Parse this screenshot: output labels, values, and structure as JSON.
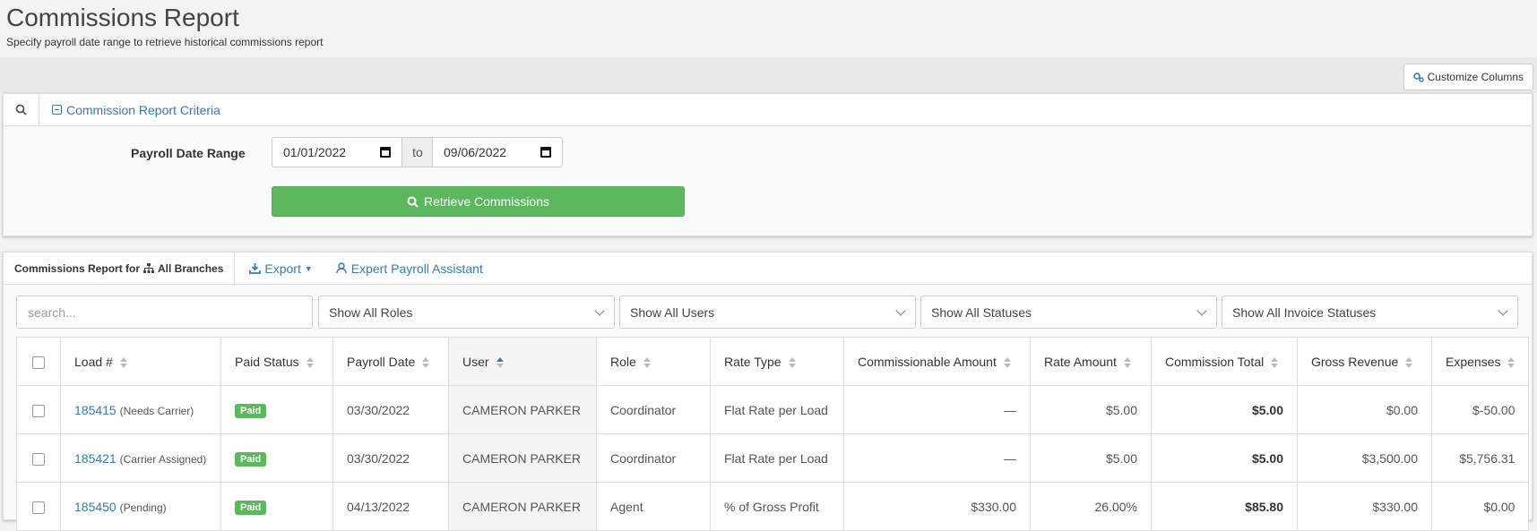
{
  "page": {
    "title": "Commissions Report",
    "subtitle": "Specify payroll date range to retrieve historical commissions report"
  },
  "toolbar": {
    "customize_label": "Customize Columns"
  },
  "criteria": {
    "header_label": "Commission Report Criteria",
    "range_label": "Payroll Date Range",
    "from_date": "01/01/2022",
    "to_label": "to",
    "to_date": "09/06/2022",
    "retrieve_label": "Retrieve Commissions"
  },
  "report": {
    "title_prefix": "Commissions Report for",
    "branch_label": "All Branches",
    "export_label": "Export",
    "assistant_label": "Expert Payroll Assistant",
    "search_placeholder": "search...",
    "filters": [
      "Show All Roles",
      "Show All Users",
      "Show All Statuses",
      "Show All Invoice Statuses"
    ],
    "columns": [
      "Load #",
      "Paid Status",
      "Payroll Date",
      "User",
      "Role",
      "Rate Type",
      "Commissionable Amount",
      "Rate Amount",
      "Commission Total",
      "Gross Revenue",
      "Expenses"
    ],
    "rows": [
      {
        "load": "185415",
        "load_status": "(Needs Carrier)",
        "paid": "Paid",
        "date": "03/30/2022",
        "user": "CAMERON PARKER",
        "role": "Coordinator",
        "rate_type": "Flat Rate per Load",
        "commissionable": "—",
        "rate": "$5.00",
        "total": "$5.00",
        "gross": "$0.00",
        "expenses": "$-50.00"
      },
      {
        "load": "185421",
        "load_status": "(Carrier Assigned)",
        "paid": "Paid",
        "date": "03/30/2022",
        "user": "CAMERON PARKER",
        "role": "Coordinator",
        "rate_type": "Flat Rate per Load",
        "commissionable": "—",
        "rate": "$5.00",
        "total": "$5.00",
        "gross": "$3,500.00",
        "expenses": "$5,756.31"
      },
      {
        "load": "185450",
        "load_status": "(Pending)",
        "paid": "Paid",
        "date": "04/13/2022",
        "user": "CAMERON PARKER",
        "role": "Agent",
        "rate_type": "% of Gross Profit",
        "commissionable": "$330.00",
        "rate": "26.00%",
        "total": "$85.80",
        "gross": "$330.00",
        "expenses": "$0.00"
      }
    ]
  }
}
